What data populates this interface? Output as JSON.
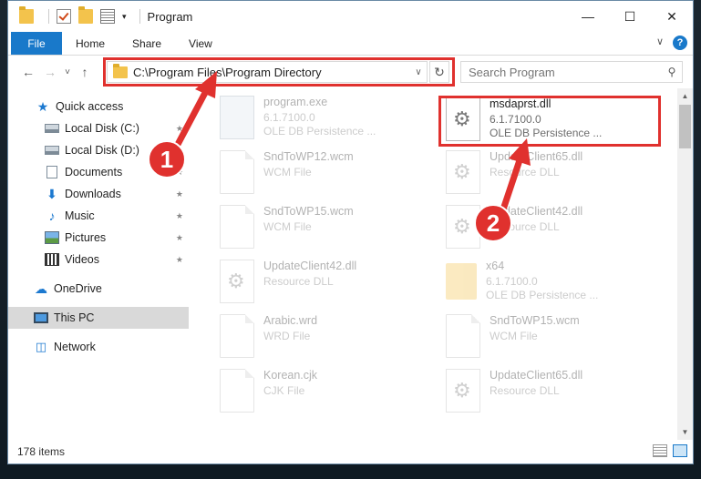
{
  "window": {
    "title": "Program",
    "controls": {
      "minimize": "—",
      "maximize": "☐",
      "close": "✕"
    }
  },
  "ribbon": {
    "file_tab": "File",
    "tabs": [
      "Home",
      "Share",
      "View"
    ],
    "expand": "∨",
    "help": "?"
  },
  "nav": {
    "back": "←",
    "forward": "→",
    "recent": "˅",
    "up": "↑"
  },
  "address": {
    "path": "C:\\Program Files\\Program Directory",
    "dropdown": "∨",
    "refresh": "↻"
  },
  "search": {
    "placeholder": "Search Program",
    "icon": "search-icon"
  },
  "sidebar": {
    "items": [
      {
        "label": "Quick access",
        "icon": "star-icon"
      },
      {
        "label": "Local Disk (C:)",
        "icon": "disk-icon"
      },
      {
        "label": "Local Disk (D:)",
        "icon": "disk-icon"
      },
      {
        "label": "Documents",
        "icon": "documents-icon"
      },
      {
        "label": "Downloads",
        "icon": "downloads-icon"
      },
      {
        "label": "Music",
        "icon": "music-icon"
      },
      {
        "label": "Pictures",
        "icon": "pictures-icon"
      },
      {
        "label": "Videos",
        "icon": "videos-icon"
      },
      {
        "label": "OneDrive",
        "icon": "cloud-icon"
      },
      {
        "label": "This PC",
        "icon": "pc-icon"
      },
      {
        "label": "Network",
        "icon": "network-icon"
      }
    ],
    "pin_glyph": "★"
  },
  "files": [
    {
      "name": "program.exe",
      "line2": "6.1.7100.0",
      "line3": "OLE DB Persistence ...",
      "icon": "exe-icon"
    },
    {
      "name": "msdaprst.dll",
      "line2": "6.1.7100.0",
      "line3": "OLE DB Persistence ...",
      "icon": "gear-file-icon"
    },
    {
      "name": "SndToWP12.wcm",
      "line2": "WCM File",
      "icon": "page-icon"
    },
    {
      "name": "UpdateClient65.dll",
      "line2": "Resource DLL",
      "icon": "gear-file-icon"
    },
    {
      "name": "SndToWP15.wcm",
      "line2": "WCM File",
      "icon": "page-icon"
    },
    {
      "name": "UpdateClient42.dll",
      "line2": "Resource DLL",
      "icon": "gear-file-icon"
    },
    {
      "name": "UpdateClient42.dll",
      "line2": "Resource DLL",
      "icon": "gear-file-icon"
    },
    {
      "name": "x64",
      "line2": "6.1.7100.0",
      "line3": "OLE DB Persistence ...",
      "icon": "folder-icon"
    },
    {
      "name": "Arabic.wrd",
      "line2": "WRD File",
      "icon": "page-icon"
    },
    {
      "name": "SndToWP15.wcm",
      "line2": "WCM File",
      "icon": "page-icon"
    },
    {
      "name": "Korean.cjk",
      "line2": "CJK File",
      "icon": "page-icon"
    },
    {
      "name": "UpdateClient65.dll",
      "line2": "Resource DLL",
      "icon": "gear-file-icon"
    }
  ],
  "status": {
    "item_count": "178 items"
  },
  "annotations": {
    "marker_1": "1",
    "marker_2": "2",
    "color": "#e0312e"
  },
  "colors": {
    "accent": "#1979ca",
    "highlight": "#e0312e"
  }
}
